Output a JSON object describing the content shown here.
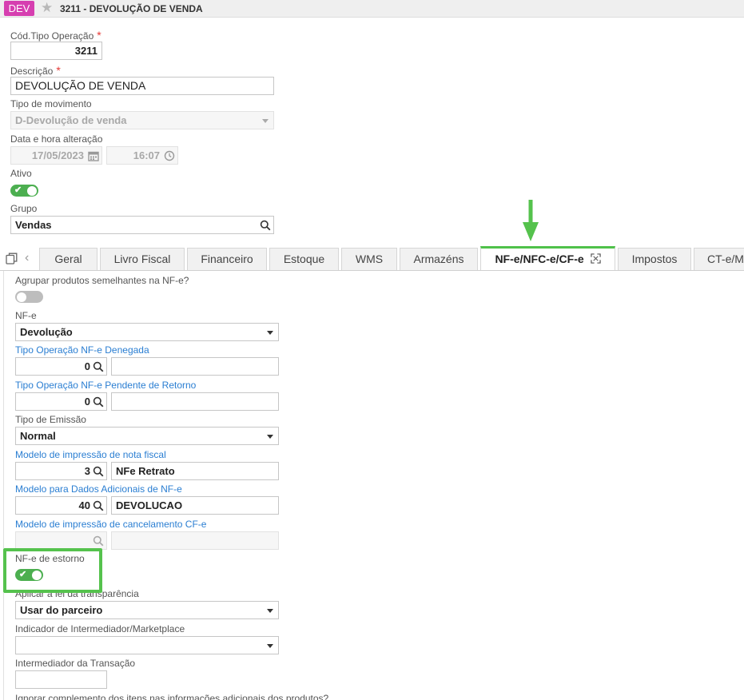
{
  "window": {
    "badge": "DEV",
    "title": "3211 - DEVOLUÇÃO DE VENDA"
  },
  "header": {
    "cod_tipo_label": "Cód.Tipo Operação",
    "cod_tipo_value": "3211",
    "descricao_label": "Descrição",
    "descricao_value": "DEVOLUÇÃO DE VENDA",
    "tipo_mov_label": "Tipo de movimento",
    "tipo_mov_value": "D-Devolução de venda",
    "data_label": "Data e hora alteração",
    "data_value": "17/05/2023",
    "hora_value": "16:07",
    "ativo_label": "Ativo",
    "ativo_on": true,
    "grupo_label": "Grupo",
    "grupo_value": "Vendas",
    "required_mark": "*"
  },
  "tabs": [
    {
      "label": "Geral"
    },
    {
      "label": "Livro Fiscal"
    },
    {
      "label": "Financeiro"
    },
    {
      "label": "Estoque"
    },
    {
      "label": "WMS"
    },
    {
      "label": "Armazéns"
    },
    {
      "label": "NF-e/NFC-e/CF-e",
      "active": true
    },
    {
      "label": "Impostos"
    },
    {
      "label": "CT-e/M"
    }
  ],
  "form": {
    "agrupar_label": "Agrupar produtos semelhantes na NF-e?",
    "nfe_label": "NF-e",
    "nfe_value": "Devolução",
    "denegada_label": "Tipo Operação NF-e Denegada",
    "denegada_code": "0",
    "denegada_desc": "",
    "pendente_label": "Tipo Operação NF-e Pendente de Retorno",
    "pendente_code": "0",
    "pendente_desc": "",
    "emissao_label": "Tipo de Emissão",
    "emissao_value": "Normal",
    "modelo_nf_label": "Modelo de impressão de nota fiscal",
    "modelo_nf_code": "3",
    "modelo_nf_desc": "NFe Retrato",
    "dados_adic_label": "Modelo para Dados Adicionais de NF-e",
    "dados_adic_code": "40",
    "dados_adic_desc": "DEVOLUCAO",
    "cancel_label": "Modelo de impressão de cancelamento CF-e",
    "cancel_code": "",
    "estorno_label": "NF-e de estorno",
    "lei_label": "Aplicar a lei da transparência",
    "lei_value": "Usar do parceiro",
    "intermediador_ind_label": "Indicador de Intermediador/Marketplace",
    "intermediador_ind_value": "",
    "intermediador_label": "Intermediador da Transação",
    "intermediador_value": "",
    "ignorar_label": "Ignorar complemento dos itens nas informações adicionais dos produtos?"
  },
  "colors": {
    "accent_green": "#4caf50",
    "highlight_green": "#55c24d",
    "link_blue": "#2a7ed2",
    "badge_magenta": "#d63fb0"
  },
  "icons": [
    "star-icon",
    "calendar-icon",
    "clock-icon",
    "search-icon",
    "copy-icon",
    "chevron-left-icon",
    "expand-icon",
    "arrow-down-icon",
    "check-icon"
  ]
}
